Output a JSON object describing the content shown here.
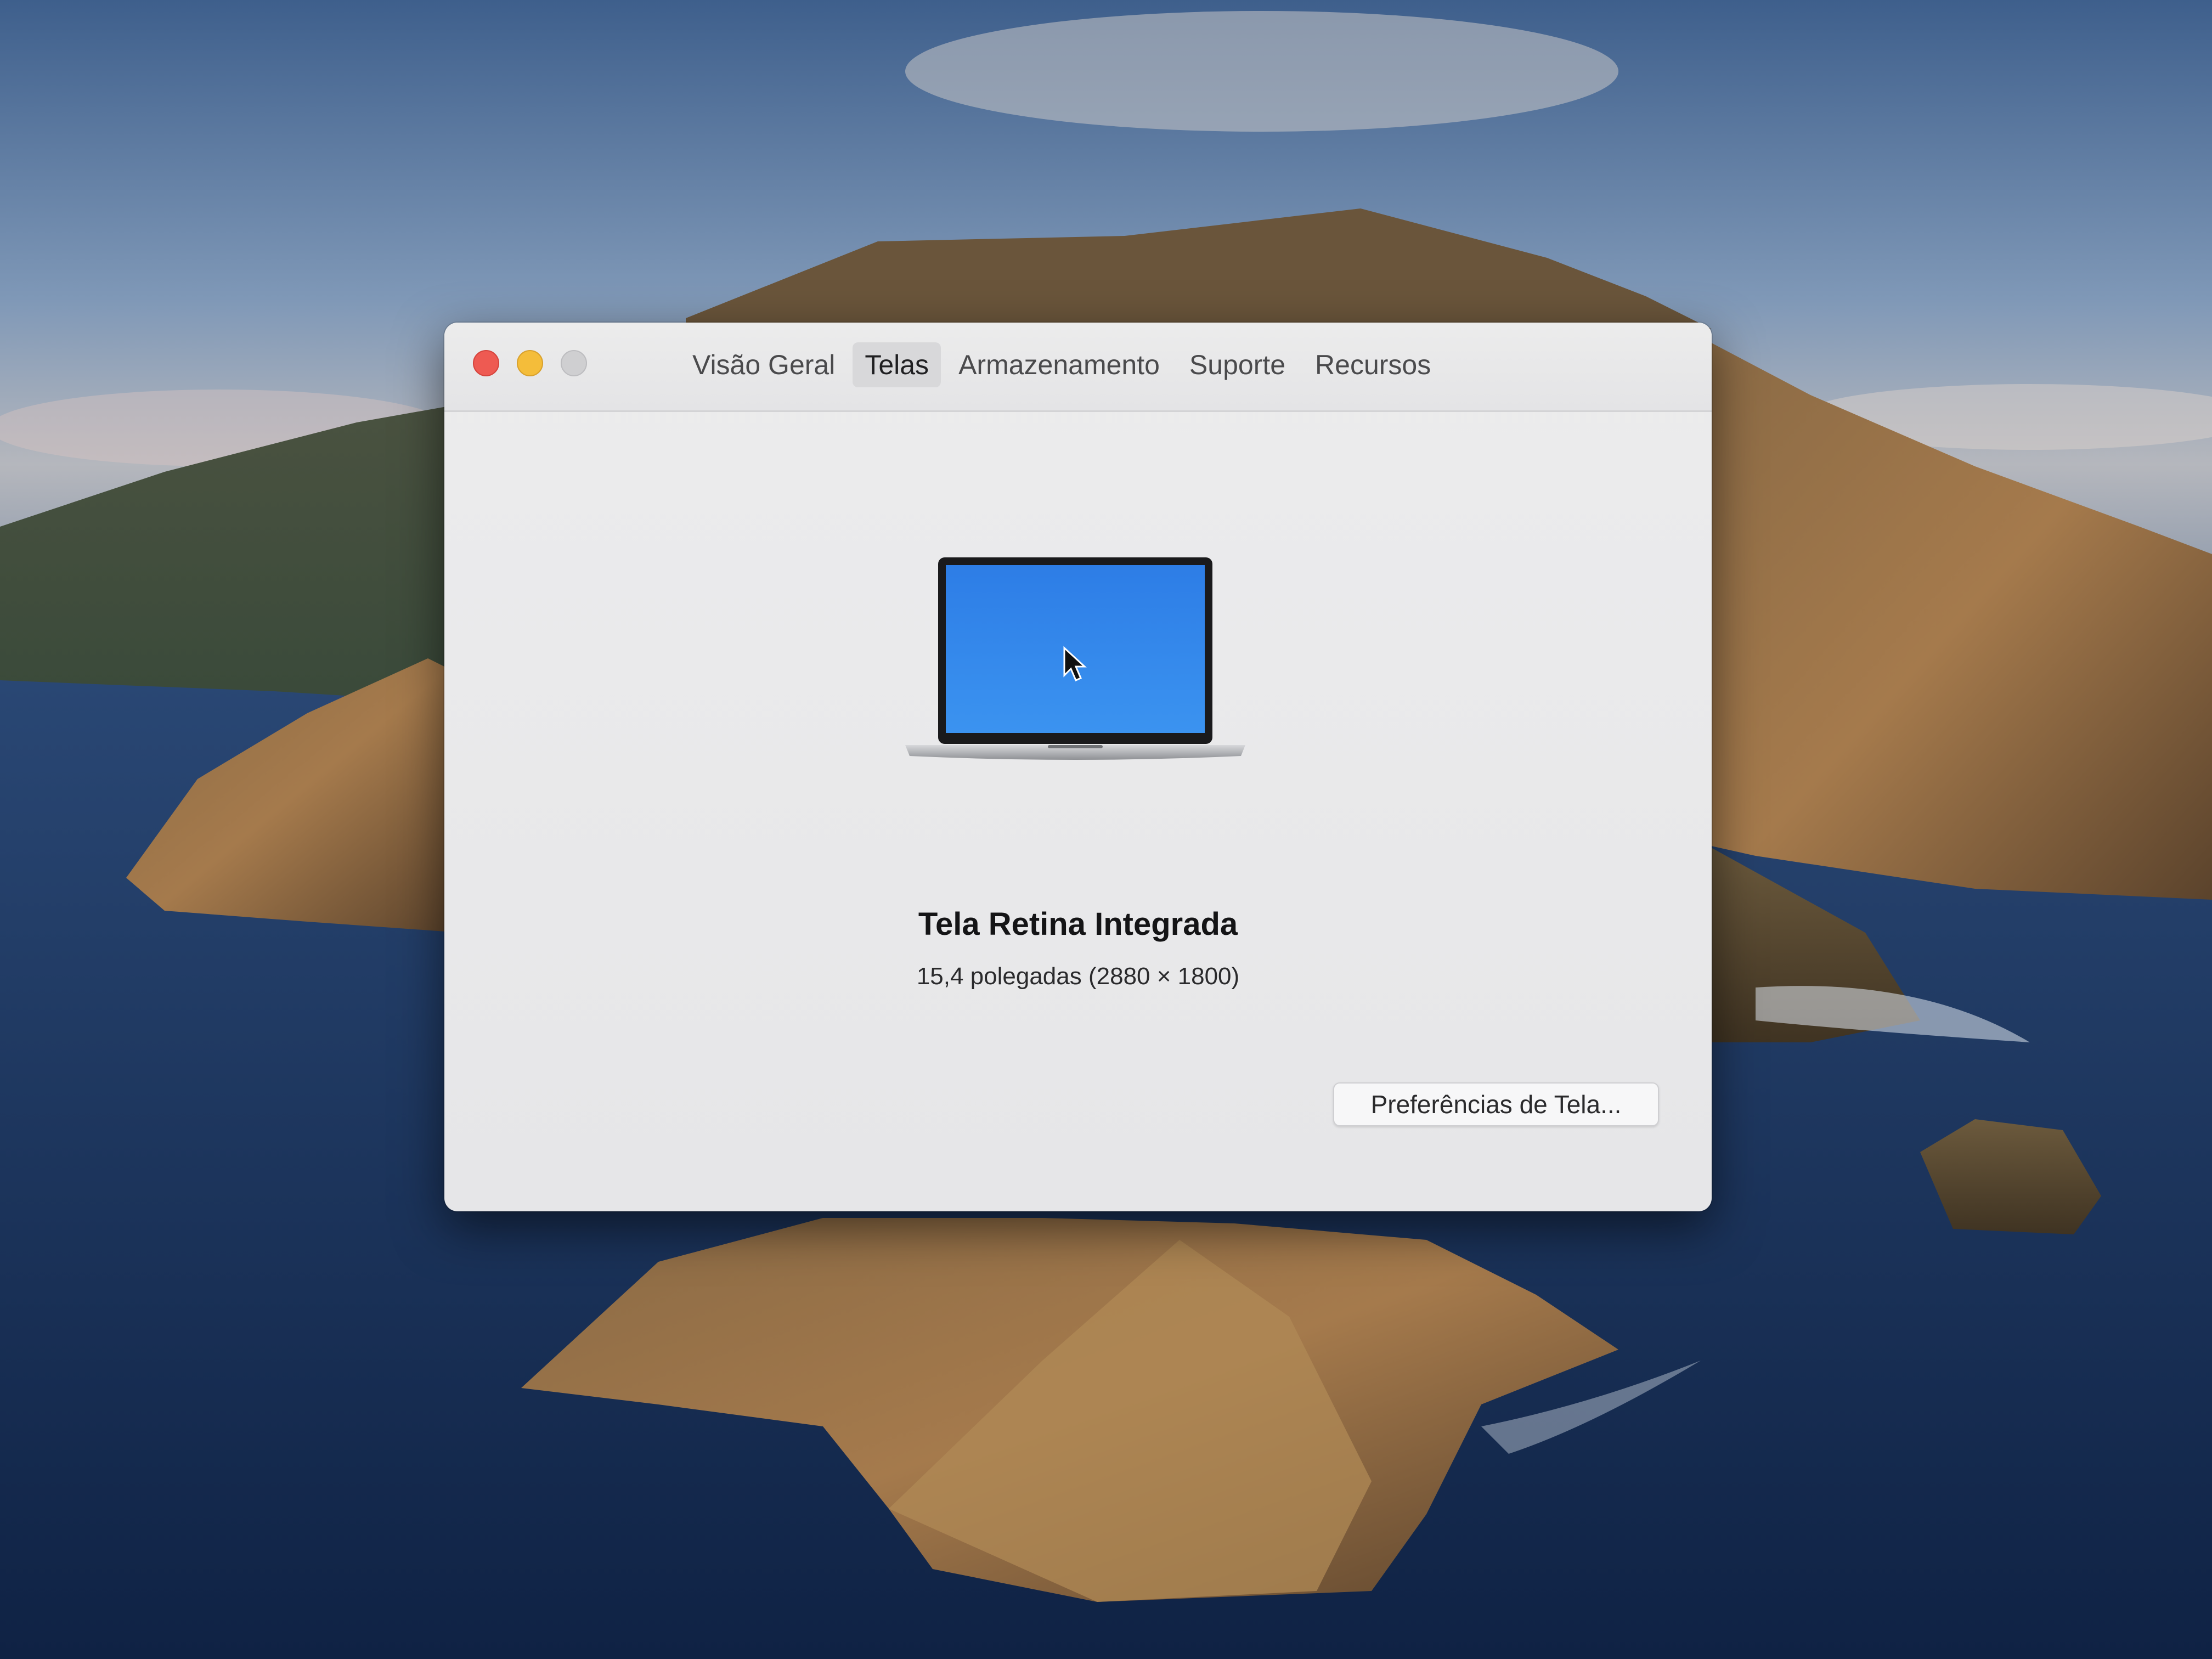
{
  "window": {
    "controls": {
      "close": "close-icon",
      "minimize": "minimize-icon",
      "zoom": "zoom-icon"
    },
    "tabs": [
      {
        "label": "Visão Geral",
        "active": false
      },
      {
        "label": "Telas",
        "active": true
      },
      {
        "label": "Armazenamento",
        "active": false
      },
      {
        "label": "Suporte",
        "active": false
      },
      {
        "label": "Recursos",
        "active": false
      }
    ]
  },
  "display": {
    "icon": "laptop-icon",
    "name": "Tela Retina Integrada",
    "detail": "15,4 polegadas (2880 × 1800)"
  },
  "actions": {
    "preferences_label": "Preferências de Tela..."
  },
  "colors": {
    "close": "#ee5a52",
    "minimize": "#f4bd3a",
    "zoom_disabled": "#cfcfd1",
    "laptop_screen": "#2f84ea"
  }
}
